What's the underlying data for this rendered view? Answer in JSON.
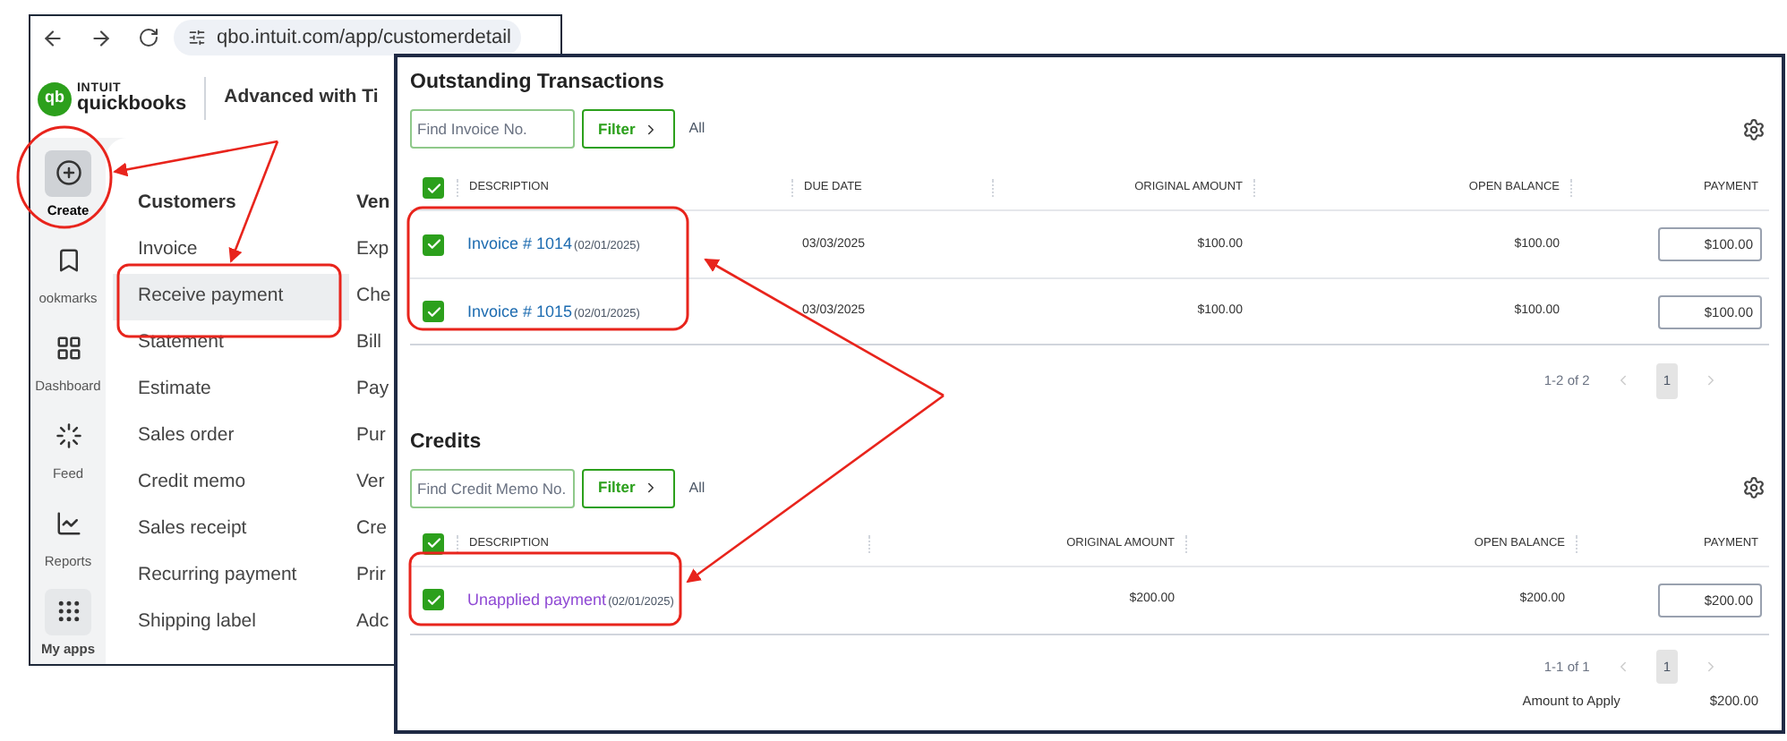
{
  "browser": {
    "address": "qbo.intuit.com/app/customerdetail"
  },
  "app": {
    "brand_top": "INTUIT",
    "brand_name": "quickbooks",
    "logo_mark": "qb",
    "company": "Advanced with Ti"
  },
  "sidebar": {
    "items": [
      {
        "label": "Create",
        "kind": "create",
        "selected": true
      },
      {
        "label": "ookmarks",
        "kind": "bookmarks",
        "selected": false
      },
      {
        "label": "Dashboard",
        "kind": "dashboard",
        "selected": false
      },
      {
        "label": "Feed",
        "kind": "feed",
        "selected": false
      },
      {
        "label": "Reports",
        "kind": "reports",
        "selected": false
      },
      {
        "label": "My apps",
        "kind": "apps",
        "selected": false
      }
    ]
  },
  "create_menu": {
    "columns": [
      {
        "title": "Customers",
        "items": [
          {
            "label": "Invoice",
            "selected": false
          },
          {
            "label": "Receive payment",
            "selected": true
          },
          {
            "label": "Statement",
            "selected": false
          },
          {
            "label": "Estimate",
            "selected": false
          },
          {
            "label": "Sales order",
            "selected": false
          },
          {
            "label": "Credit memo",
            "selected": false
          },
          {
            "label": "Sales receipt",
            "selected": false
          },
          {
            "label": "Recurring payment",
            "selected": false
          },
          {
            "label": "Shipping label",
            "selected": false
          }
        ]
      },
      {
        "title": "Ven",
        "items": [
          {
            "label": "Exp",
            "selected": false
          },
          {
            "label": "Che",
            "selected": false
          },
          {
            "label": "Bill",
            "selected": false
          },
          {
            "label": "Pay",
            "selected": false
          },
          {
            "label": "Pur",
            "selected": false
          },
          {
            "label": "Ver",
            "selected": false
          },
          {
            "label": "Cre",
            "selected": false
          },
          {
            "label": "Prir",
            "selected": false
          },
          {
            "label": "Adc",
            "selected": false
          }
        ]
      }
    ]
  },
  "outstanding": {
    "title": "Outstanding Transactions",
    "search": {
      "placeholder": "Find Invoice No."
    },
    "filter": "Filter",
    "filter_value": "All",
    "columns": [
      "DESCRIPTION",
      "DUE DATE",
      "ORIGINAL AMOUNT",
      "OPEN BALANCE",
      "PAYMENT"
    ],
    "all_checked": true,
    "rows": [
      {
        "checked": true,
        "link": "Invoice # 1014",
        "date": "(02/01/2025)",
        "due_date": "03/03/2025",
        "original": "$100.00",
        "open": "$100.00",
        "payment": "$100.00"
      },
      {
        "checked": true,
        "link": "Invoice # 1015",
        "date": "(02/01/2025)",
        "due_date": "03/03/2025",
        "original": "$100.00",
        "open": "$100.00",
        "payment": "$100.00"
      }
    ],
    "pagination": {
      "range": "1-2 of 2",
      "page": "1"
    }
  },
  "credits": {
    "title": "Credits",
    "search": {
      "placeholder": "Find Credit Memo No."
    },
    "filter": "Filter",
    "filter_value": "All",
    "columns": [
      "DESCRIPTION",
      "ORIGINAL AMOUNT",
      "OPEN BALANCE",
      "PAYMENT"
    ],
    "all_checked": true,
    "rows": [
      {
        "checked": true,
        "link": "Unapplied payment",
        "date": "(02/01/2025)",
        "original": "$200.00",
        "open": "$200.00",
        "payment": "$200.00"
      }
    ],
    "pagination": {
      "range": "1-1 of 1",
      "page": "1"
    }
  },
  "amount_to_apply": {
    "label": "Amount to Apply",
    "value": "$200.00"
  }
}
